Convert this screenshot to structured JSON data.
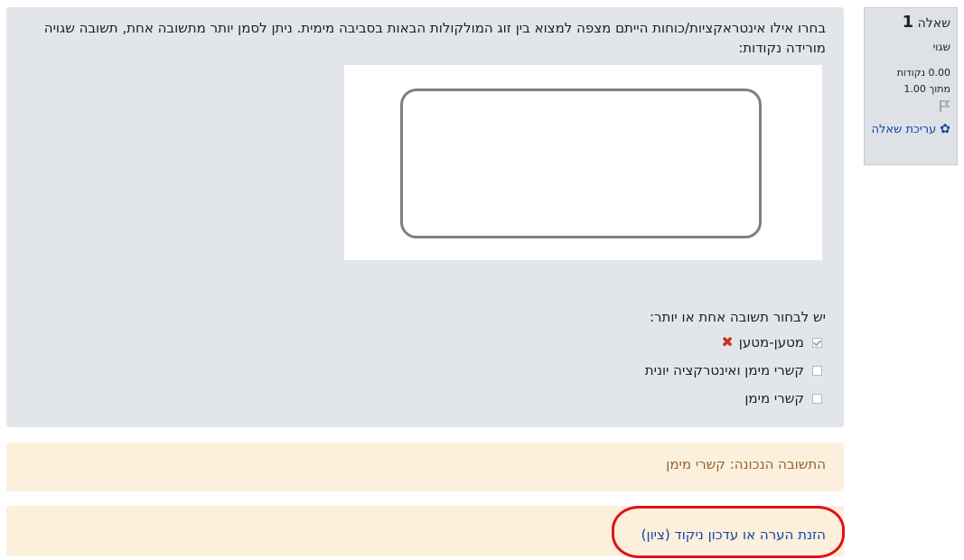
{
  "question_info": {
    "label": "שאלה",
    "number": "1",
    "state": "שגוי",
    "mark": "0.00 נקודות",
    "max_mark": "מתוך 1.00",
    "flag_icon": "flag-icon",
    "edit_label": "עריכת שאלה"
  },
  "question": {
    "text": "בחרו אילו אינטראקציות/כוחות הייתם מצפה למצוא בין זוג המולקולות הבאות בסביבה מימית. ניתן לסמן יותר מתשובה אחת, תשובה שגויה מורידה נקודות:",
    "prompt": "יש לבחור תשובה אחת או יותר:",
    "options": [
      {
        "label": "מטען-מטען",
        "checked": true,
        "feedback_icon": "incorrect-icon"
      },
      {
        "label": "קשרי מימן ואינטרקציה יונית",
        "checked": false
      },
      {
        "label": "קשרי מימן",
        "checked": false
      }
    ]
  },
  "feedback": {
    "right_answer": "התשובה הנכונה: קשרי מימן"
  },
  "comment": {
    "link_label": "הזנת הערה או עדכון ניקוד (ציון)"
  }
}
